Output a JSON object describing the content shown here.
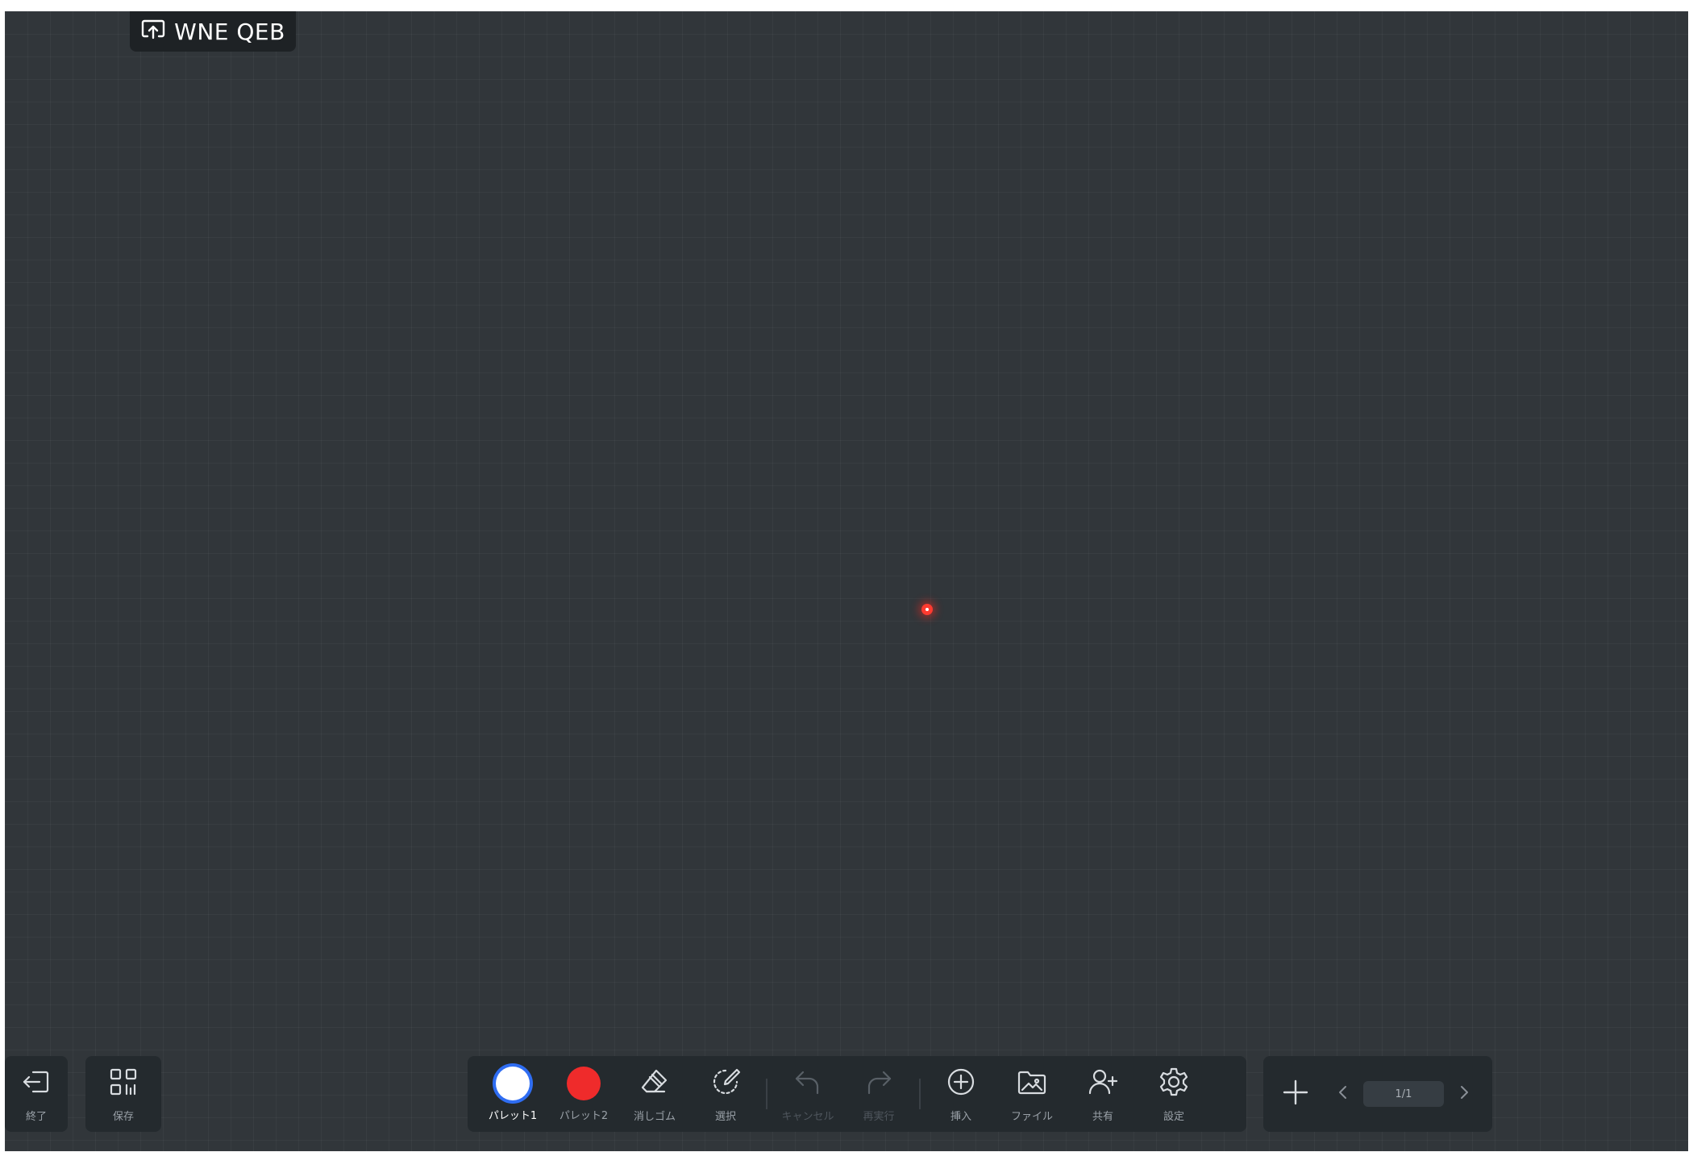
{
  "header": {
    "badge_label": "WNE QEB",
    "badge_icon": "screen-share-icon"
  },
  "left_tools": {
    "exit_label": "終了",
    "save_label": "保存"
  },
  "toolbar": {
    "palette1_label": "パレット1",
    "palette1_color": "#ffffff",
    "palette2_label": "パレット2",
    "palette2_color": "#ef2b2b",
    "eraser_label": "消しゴム",
    "select_label": "選択",
    "undo_label": "キャンセル",
    "redo_label": "再実行",
    "insert_label": "挿入",
    "file_label": "ファイル",
    "share_label": "共有",
    "settings_label": "設定",
    "active_tool": "パレット1",
    "accent_color": "#2f6df2"
  },
  "pages": {
    "indicator": "1/1"
  },
  "canvas": {
    "background_color": "#31363a",
    "pointer_color": "#ff3b30"
  }
}
